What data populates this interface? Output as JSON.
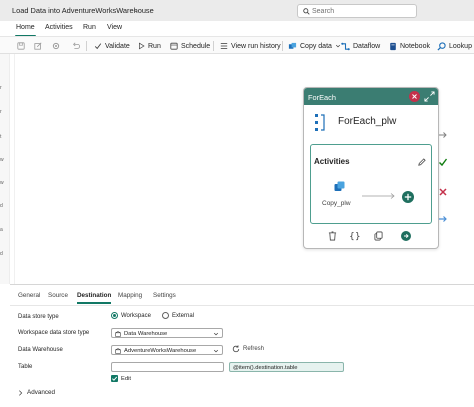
{
  "titlebar": {
    "pipeline_name": "Load Data into AdventureWorksWarehouse",
    "search_placeholder": "Search"
  },
  "tabs": [
    {
      "label": "Home",
      "active": true
    },
    {
      "label": "Activities",
      "active": false
    },
    {
      "label": "Run",
      "active": false
    },
    {
      "label": "View",
      "active": false
    }
  ],
  "toolbar": {
    "validate": "Validate",
    "run": "Run",
    "schedule": "Schedule",
    "view_run_history": "View run history",
    "copy_data": "Copy data",
    "dataflow": "Dataflow",
    "notebook": "Notebook",
    "lookup": "Lookup"
  },
  "left_strip_fragments": [
    "r",
    "r",
    "t",
    "w",
    "w",
    "d",
    "a",
    "d"
  ],
  "foreach": {
    "header": "ForEach",
    "name": "ForEach_plw",
    "activities_label": "Activities",
    "inner_activity": "Copy_plw"
  },
  "panel": {
    "tabs": [
      {
        "label": "General",
        "active": false
      },
      {
        "label": "Source",
        "active": false
      },
      {
        "label": "Destination",
        "active": true
      },
      {
        "label": "Mapping",
        "active": false
      },
      {
        "label": "Settings",
        "active": false
      }
    ],
    "data_store_type_label": "Data store type",
    "radio_workspace": "Workspace",
    "radio_external": "External",
    "workspace_data_store_type_label": "Workspace data store type",
    "workspace_data_store_type_value": "Data Warehouse",
    "data_warehouse_label": "Data Warehouse",
    "data_warehouse_value": "AdventureWorksWarehouse",
    "refresh_label": "Refresh",
    "table_label": "Table",
    "table_value": "@item().destination.table",
    "edit_label": "Edit",
    "advanced_label": "Advanced"
  },
  "colors": {
    "accent": "#117865",
    "foreach_header": "#3b7d72",
    "delete_red": "#c4314b"
  }
}
